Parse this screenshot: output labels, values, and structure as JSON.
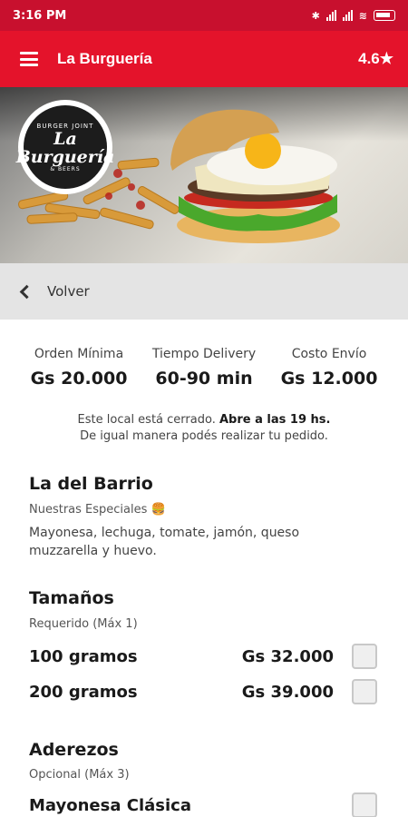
{
  "status_bar": {
    "time": "3:16 PM"
  },
  "app_bar": {
    "title": "La Burguería",
    "rating": "4.6★"
  },
  "hero": {
    "logo_top": "BURGER JOINT",
    "logo_name": "La Burguería",
    "logo_bottom": "& BEERS"
  },
  "back": {
    "label": "Volver"
  },
  "info": [
    {
      "label": "Orden Mínima",
      "value": "Gs 20.000"
    },
    {
      "label": "Tiempo Delivery",
      "value": "60-90 min"
    },
    {
      "label": "Costo Envío",
      "value": "Gs 12.000"
    }
  ],
  "notice": {
    "line1_text": "Este local está cerrado.",
    "line1_bold": "Abre a las 19 hs.",
    "line2": "De igual manera podés realizar tu pedido."
  },
  "product": {
    "name": "La del Barrio",
    "category": "Nuestras Especiales 🍔",
    "description": "Mayonesa, lechuga, tomate, jamón, queso muzzarella y huevo."
  },
  "sizes": {
    "title": "Tamaños",
    "requirement": "Requerido (Máx 1)",
    "options": [
      {
        "name": "100 gramos",
        "price": "Gs 32.000"
      },
      {
        "name": "200 gramos",
        "price": "Gs 39.000"
      }
    ]
  },
  "dressings": {
    "title": "Aderezos",
    "requirement": "Opcional (Máx 3)",
    "options": [
      {
        "name": "Mayonesa Clásica"
      }
    ]
  },
  "colors": {
    "brand_red": "#e4132b",
    "status_red": "#c8102e"
  }
}
